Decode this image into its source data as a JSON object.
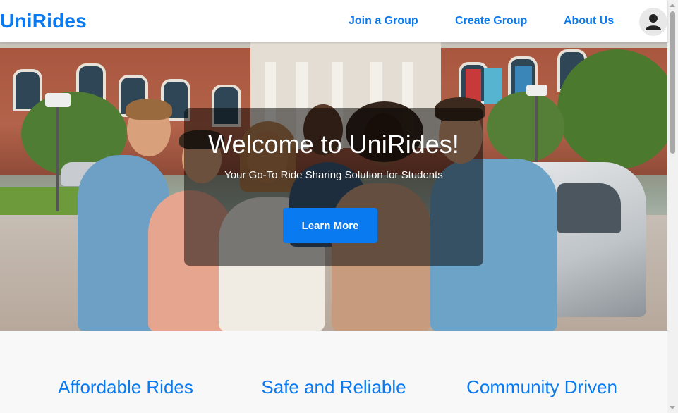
{
  "header": {
    "logo": "UniRides",
    "nav": {
      "join": "Join a Group",
      "create": "Create Group",
      "about": "About Us"
    },
    "profile_icon": "user-icon"
  },
  "hero": {
    "title": "Welcome to UniRides!",
    "subtitle": "Your Go-To Ride Sharing Solution for Students",
    "button_label": "Learn More",
    "image": "students-with-car-photo"
  },
  "features": [
    {
      "title": "Affordable Rides"
    },
    {
      "title": "Safe and Reliable"
    },
    {
      "title": "Community Driven"
    }
  ],
  "colors": {
    "accent": "#0a7af0",
    "features_bg": "#f8f8f8",
    "overlay": "rgba(0,0,0,0.5)"
  }
}
